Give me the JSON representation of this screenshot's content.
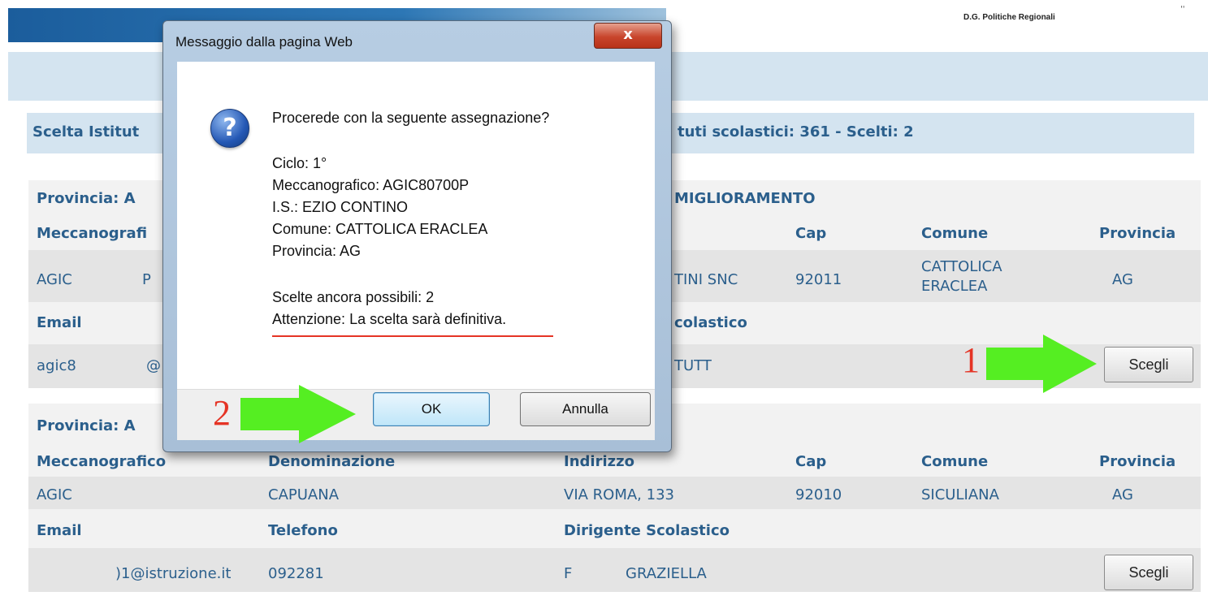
{
  "header": {
    "org_text": "D.G. Politiche Regionali",
    "corner_text": "''"
  },
  "page_title": {
    "left": "Scelta Istitut",
    "right": "tuti scolastici: 361 - Scelti: 2"
  },
  "cards": [
    {
      "provincia_label": "Provincia: A",
      "program_label": "MIGLIORAMENTO",
      "columns": [
        "Meccanografi",
        "Cap",
        "Comune",
        "Provincia"
      ],
      "values": {
        "meccanografico_a": "AGIC",
        "meccanografico_b": "P",
        "indirizzo": "TINI SNC",
        "cap": "92011",
        "comune_line1": "CATTOLICA",
        "comune_line2": "ERACLEA",
        "provincia": "AG"
      },
      "secondary": {
        "email_label": "Email",
        "dirigente_label": "colastico",
        "email_a": "agic8",
        "email_b": "@",
        "dirigente": "TUTT"
      },
      "choose_label": "Scegli"
    },
    {
      "provincia_label": "Provincia: A",
      "columns": [
        "Meccanografico",
        "Denominazione",
        "Indirizzo",
        "Cap",
        "Comune",
        "Provincia"
      ],
      "values": {
        "meccanografico": "AGIC",
        "denominazione": "CAPUANA",
        "indirizzo": "VIA ROMA, 133",
        "cap": "92010",
        "comune": "SICULIANA",
        "provincia": "AG"
      },
      "secondary": {
        "email_label": "Email",
        "telefono_label": "Telefono",
        "dirigente_label": "Dirigente Scolastico",
        "email": ")1@istruzione.it",
        "telefono": "092281",
        "dirigente_a": "F",
        "dirigente_b": "GRAZIELLA"
      },
      "choose_label": "Scegli"
    }
  ],
  "annotations": {
    "step1": "1",
    "step2": "2",
    "arrow_color": "#55ee22",
    "number_color": "#e53425"
  },
  "dialog": {
    "title": "Messaggio dalla pagina Web",
    "close_label": "x",
    "icon": "question-icon",
    "question": "Procerede con la seguente assegnazione?",
    "ciclo": "Ciclo: 1°",
    "meccanografico": "Meccanografico: AGIC80700P",
    "is": "I.S.: EZIO CONTINO",
    "comune": "Comune: CATTOLICA ERACLEA",
    "provincia": "Provincia: AG",
    "scelte": "Scelte ancora possibili: 2",
    "attenzione": "Attenzione: La scelta sarà definitiva.",
    "ok_label": "OK",
    "cancel_label": "Annulla"
  }
}
